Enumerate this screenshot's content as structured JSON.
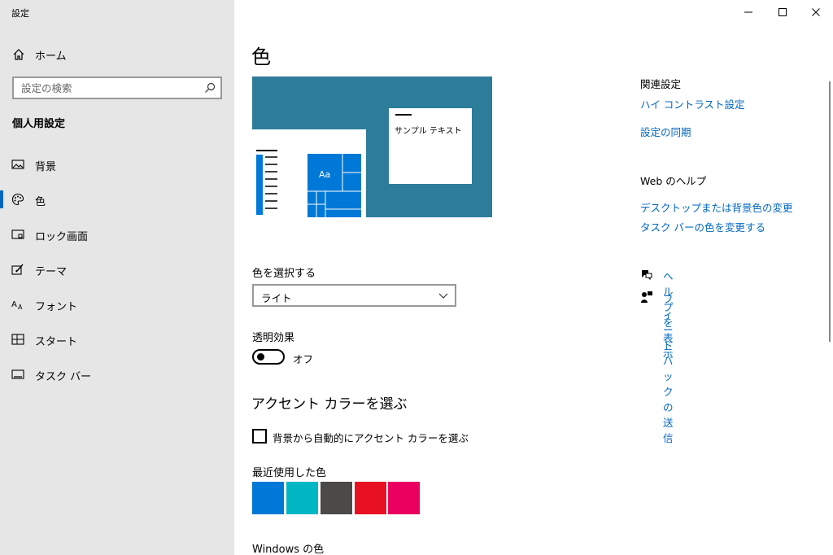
{
  "app": {
    "title": "設定"
  },
  "window_controls": {
    "minimize": "—",
    "maximize": "☐",
    "close": "✕"
  },
  "sidebar": {
    "home_label": "ホーム",
    "search_placeholder": "設定の検索",
    "section_title": "個人用設定",
    "items": [
      {
        "label": "背景",
        "icon": "picture-icon"
      },
      {
        "label": "色",
        "icon": "palette-icon",
        "active": true
      },
      {
        "label": "ロック画面",
        "icon": "lock-screen-icon"
      },
      {
        "label": "テーマ",
        "icon": "theme-icon"
      },
      {
        "label": "フォント",
        "icon": "font-icon"
      },
      {
        "label": "スタート",
        "icon": "start-icon"
      },
      {
        "label": "タスク バー",
        "icon": "taskbar-icon"
      }
    ]
  },
  "main": {
    "title": "色",
    "preview": {
      "sample_text": "サンプル テキスト",
      "tile_label": "Aa"
    },
    "choose_color_label": "色を選択する",
    "choose_color_value": "ライト",
    "transparency_label": "透明効果",
    "transparency_state": "オフ",
    "accent_heading": "アクセント カラーを選ぶ",
    "auto_accent_label": "背景から自動的にアクセント カラーを選ぶ",
    "recent_colors_label": "最近使用した色",
    "recent_colors": [
      "#0078d7",
      "#00b7c3",
      "#4c4a48",
      "#e81123",
      "#ea005e"
    ],
    "windows_colors_label": "Windows の色"
  },
  "right": {
    "related_heading": "関連設定",
    "related_links": [
      "ハイ コントラスト設定",
      "設定の同期"
    ],
    "web_help_heading": "Web のヘルプ",
    "web_help_links": [
      "デスクトップまたは背景色の変更",
      "タスク バーの色を変更する"
    ],
    "get_help": "ヘルプを表示",
    "feedback": "フィードバックの送信"
  },
  "colors": {
    "accent": "#0067c0",
    "preview_bg": "#2d7d9a",
    "tile_blue": "#0078d7",
    "sidebar_bg": "#e6e6e6"
  }
}
